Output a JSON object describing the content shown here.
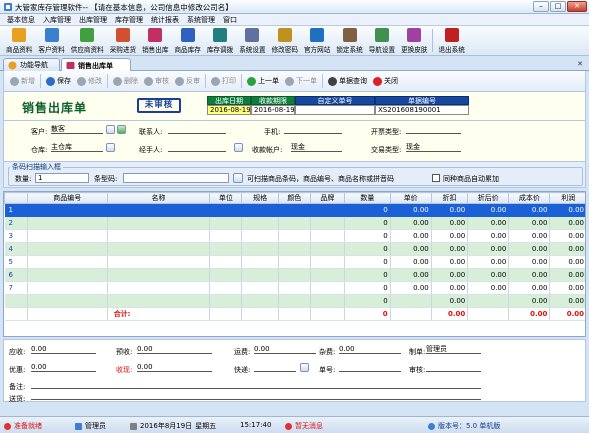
{
  "window": {
    "title": "大管家库存管理软件-- 【请在基本信息，公司信息中修改公司名】"
  },
  "menu": [
    "基本信息",
    "入库管理",
    "出库管理",
    "库存管理",
    "统计报表",
    "系统管理",
    "窗口"
  ],
  "toolbar": [
    {
      "label": "商品资料",
      "icon": "goods-icon",
      "color": "#e8a020"
    },
    {
      "label": "客户资料",
      "icon": "customer-icon",
      "color": "#3a80d0"
    },
    {
      "label": "供应商资料",
      "icon": "supplier-icon",
      "color": "#40a040"
    },
    {
      "label": "采购进货",
      "icon": "purchase-icon",
      "color": "#d05030"
    },
    {
      "label": "销售出库",
      "icon": "sales-icon",
      "color": "#c03060"
    },
    {
      "label": "商品库存",
      "icon": "stock-icon",
      "color": "#3060c0"
    },
    {
      "label": "库存调拨",
      "icon": "transfer-icon",
      "color": "#208080"
    },
    {
      "label": "系统设置",
      "icon": "settings-icon",
      "color": "#6070a0"
    },
    {
      "label": "修改密码",
      "icon": "password-icon",
      "color": "#c09020"
    },
    {
      "label": "官方网站",
      "icon": "website-icon",
      "color": "#2070c0"
    },
    {
      "label": "锁定系统",
      "icon": "lock-icon",
      "color": "#806040"
    },
    {
      "label": "导航设置",
      "icon": "navigation-icon",
      "color": "#409050"
    },
    {
      "label": "更换皮肤",
      "icon": "skin-icon",
      "color": "#a040a0"
    },
    {
      "label": "退出系统",
      "icon": "exit-icon",
      "color": "#c02020"
    }
  ],
  "tabs": {
    "nav": "功能导航",
    "active": "销售出库单"
  },
  "actions": [
    {
      "label": "新增",
      "name": "new-button",
      "disabled": true,
      "color": "#9aa6b4"
    },
    {
      "label": "保存",
      "name": "save-button",
      "disabled": false,
      "color": "#2a6ec8"
    },
    {
      "label": "修改",
      "name": "edit-button",
      "disabled": true,
      "color": "#9aa6b4"
    },
    {
      "label": "删除",
      "name": "delete-button",
      "disabled": true,
      "color": "#9aa6b4"
    },
    {
      "label": "审核",
      "name": "audit-button",
      "disabled": true,
      "color": "#9aa6b4"
    },
    {
      "label": "反审",
      "name": "unaudit-button",
      "disabled": true,
      "color": "#9aa6b4"
    },
    {
      "label": "打印",
      "name": "print-button",
      "disabled": true,
      "color": "#9aa6b4"
    },
    {
      "label": "上一单",
      "name": "prev-button",
      "disabled": false,
      "color": "#2aa040"
    },
    {
      "label": "下一单",
      "name": "next-button",
      "disabled": true,
      "color": "#9aa6b4"
    },
    {
      "label": "单据查询",
      "name": "query-button",
      "disabled": false,
      "color": "#404040"
    },
    {
      "label": "关闭",
      "name": "close-button",
      "disabled": false,
      "color": "#e02020"
    }
  ],
  "doc": {
    "title": "销售出库单",
    "stamp": "未审核",
    "out_date_label": "出库日期",
    "out_date": "2016-08-19",
    "due_label": "收款期限",
    "due": "2016-08-19",
    "custom_no_label": "自定义单号",
    "custom_no": "",
    "doc_no_label": "单据编号",
    "doc_no": "XS201608190001"
  },
  "info": {
    "customer_label": "客户:",
    "customer": "散客",
    "contact_label": "联系人:",
    "contact": "",
    "phone_label": "手机:",
    "phone": "",
    "invoice_label": "开票类型:",
    "invoice": "",
    "warehouse_label": "仓库:",
    "warehouse": "主仓库",
    "handler_label": "经手人:",
    "handler": "",
    "account_label": "收款帐户:",
    "account": "现金",
    "trade_label": "交易类型:",
    "trade": "现金"
  },
  "scan": {
    "caption": "条码扫描输入框",
    "qty_label": "数量:",
    "qty": "1",
    "barcode_label": "条型码:",
    "barcode": "",
    "hint": "可扫描商品条码，商品编号、商品名称或拼音码",
    "merge_label": "同种商品自动累加"
  },
  "grid": {
    "columns": [
      "商品编号",
      "名称",
      "单位",
      "规格",
      "颜色",
      "品牌",
      "数量",
      "单价",
      "折扣",
      "折后价",
      "成本价",
      "利润"
    ],
    "rows": [
      [
        "1",
        "",
        "",
        "",
        "",
        "",
        "",
        "0",
        "0.00",
        "0.00",
        "0.00",
        "0.00",
        "0.00"
      ],
      [
        "2",
        "",
        "",
        "",
        "",
        "",
        "",
        "0",
        "0.00",
        "0.00",
        "0.00",
        "0.00",
        "0.00"
      ],
      [
        "3",
        "",
        "",
        "",
        "",
        "",
        "",
        "0",
        "0.00",
        "0.00",
        "0.00",
        "0.00",
        "0.00"
      ],
      [
        "4",
        "",
        "",
        "",
        "",
        "",
        "",
        "0",
        "0.00",
        "0.00",
        "0.00",
        "0.00",
        "0.00"
      ],
      [
        "5",
        "",
        "",
        "",
        "",
        "",
        "",
        "0",
        "0.00",
        "0.00",
        "0.00",
        "0.00",
        "0.00"
      ],
      [
        "6",
        "",
        "",
        "",
        "",
        "",
        "",
        "0",
        "0.00",
        "0.00",
        "0.00",
        "0.00",
        "0.00"
      ],
      [
        "7",
        "",
        "",
        "",
        "",
        "",
        "",
        "0",
        "0.00",
        "0.00",
        "0.00",
        "0.00",
        "0.00"
      ],
      [
        "",
        "",
        "",
        "",
        "",
        "",
        "",
        "0",
        "",
        "0.00",
        "",
        "0.00",
        "0.00"
      ]
    ],
    "total_label": "合计:",
    "total": [
      "0",
      "0.00",
      "0.00",
      "0.00"
    ]
  },
  "footer": {
    "receivable_label": "应收:",
    "receivable": "0.00",
    "prepay_label": "预收:",
    "prepay": "0.00",
    "freight_label": "运费:",
    "freight": "0.00",
    "misc_label": "杂费:",
    "misc": "0.00",
    "maker_label": "制单:",
    "maker": "管理员",
    "discount_label": "优惠:",
    "discount": "0.00",
    "received_label": "收现:",
    "received": "0.00",
    "express_label": "快递:",
    "express": "",
    "trackno_label": "单号:",
    "trackno": "",
    "auditor_label": "审核:",
    "auditor": "",
    "remark_label": "备注:",
    "remark": "",
    "deliver_label": "送货:",
    "deliver": ""
  },
  "status": {
    "ready": "准备就绪",
    "user": "管理员",
    "date": "2016年8月19日",
    "weekday": "星期五",
    "time": "15:17:40",
    "msg": "暂无消息",
    "version": "版本号：5.0 单机版"
  },
  "colors": {
    "accent": "#0d7e3c",
    "selected": "#1c60d8",
    "alt_row": "#d6efd6",
    "total": "#e01010"
  }
}
